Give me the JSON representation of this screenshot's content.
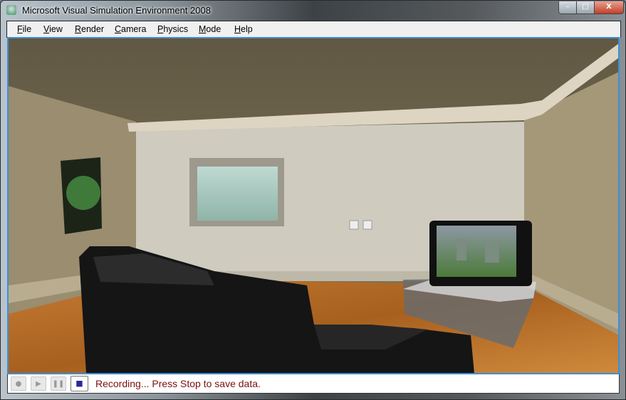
{
  "window": {
    "title": "Microsoft Visual Simulation Environment 2008",
    "controls": {
      "minimize": "–",
      "maximize": "□",
      "close": "X"
    }
  },
  "menu": [
    "File",
    "View",
    "Render",
    "Camera",
    "Physics",
    "Mode",
    "Help"
  ],
  "toolbar": {
    "buttons": [
      {
        "name": "record",
        "icon": "●",
        "enabled": false
      },
      {
        "name": "play",
        "icon": "▶",
        "enabled": false
      },
      {
        "name": "pause",
        "icon": "❚❚",
        "enabled": false
      },
      {
        "name": "stop",
        "icon": "■",
        "enabled": true
      }
    ],
    "status": "Recording...  Press Stop to save data."
  },
  "colors": {
    "accent": "#3c8fd8",
    "status_text": "#7a1010",
    "stop_icon": "#2a2a9a"
  }
}
